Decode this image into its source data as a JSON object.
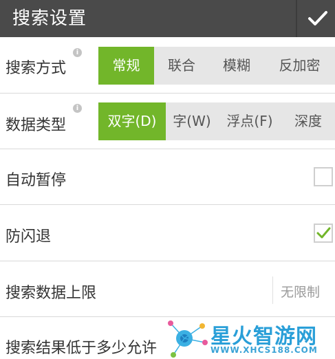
{
  "header": {
    "title": "搜索设置",
    "confirm_icon": "check-icon"
  },
  "search_mode": {
    "label": "搜索方式",
    "info_icon": "info-icon",
    "options": [
      "常规",
      "联合",
      "模糊",
      "反加密"
    ],
    "selected": "常规"
  },
  "data_type": {
    "label": "数据类型",
    "info_icon": "info-icon",
    "options": [
      "双字(D)",
      "字(W)",
      "浮点(F)",
      "深度"
    ],
    "selected": "双字(D)"
  },
  "auto_pause": {
    "label": "自动暂停",
    "checked": false
  },
  "anti_flashback": {
    "label": "防闪退",
    "checked": true
  },
  "search_limit": {
    "label": "搜索数据上限",
    "value": "无限制"
  },
  "result_threshold": {
    "label": "搜索结果低于多少允许"
  },
  "watermark": {
    "brand": "星火智游网",
    "url": "WWW.XHCS188.COM"
  },
  "colors": {
    "accent": "#72b62a",
    "titlebar": "#4a4a4a",
    "segment_bg": "#e6e6e6",
    "brand": "#2a9fd8"
  }
}
